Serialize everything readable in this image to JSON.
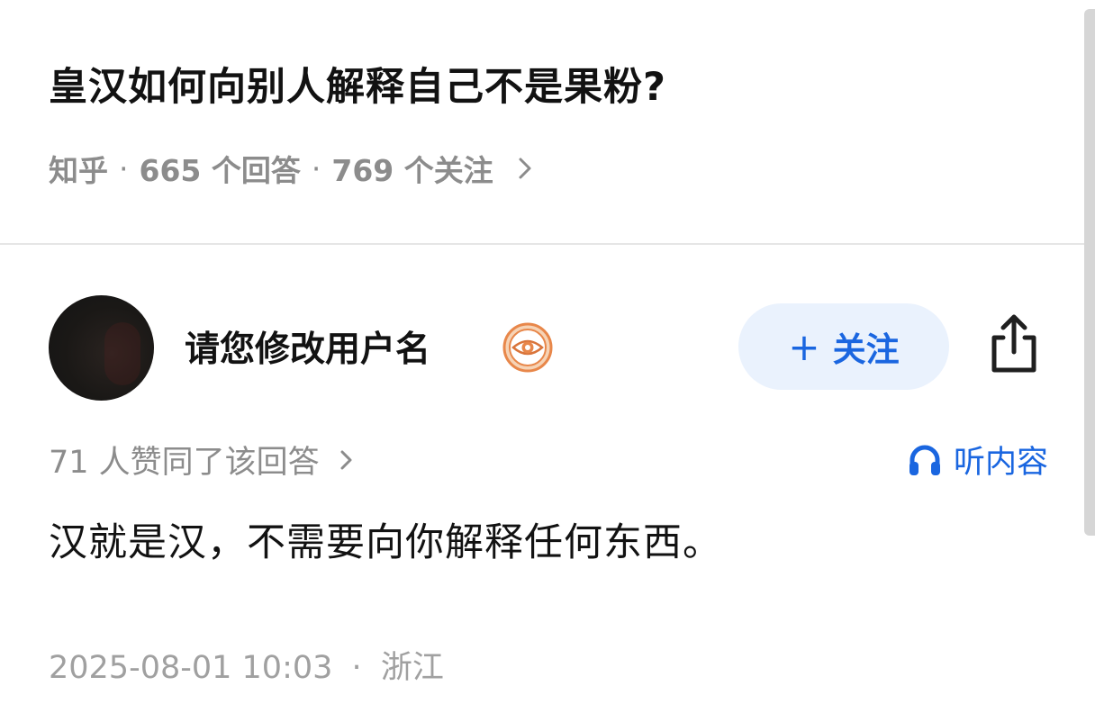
{
  "question": {
    "title": "皇汉如何向别人解释自己不是果粉?",
    "source": "知乎",
    "separator": "·",
    "answers_count": "665 个回答",
    "followers_count": "769 个关注"
  },
  "answer": {
    "author_name": "请您修改用户名",
    "follow_label": "关注",
    "follow_plus": "+",
    "upvote_text": "71 人赞同了该回答",
    "listen_label": "听内容",
    "content": "汉就是汉，不需要向你解释任何东西。",
    "timestamp": "2025-08-01 10:03",
    "location": "浙江"
  },
  "icons": {
    "badge": "eye-badge-icon",
    "share": "share-icon",
    "chevron": "chevron-right-icon",
    "listen": "headphone-icon"
  },
  "colors": {
    "accent": "#1a66e0",
    "follow_bg": "#eaf2fd",
    "muted_text": "#8c8c8c",
    "primary_text": "#121212",
    "badge_orange": "#e8874a"
  }
}
